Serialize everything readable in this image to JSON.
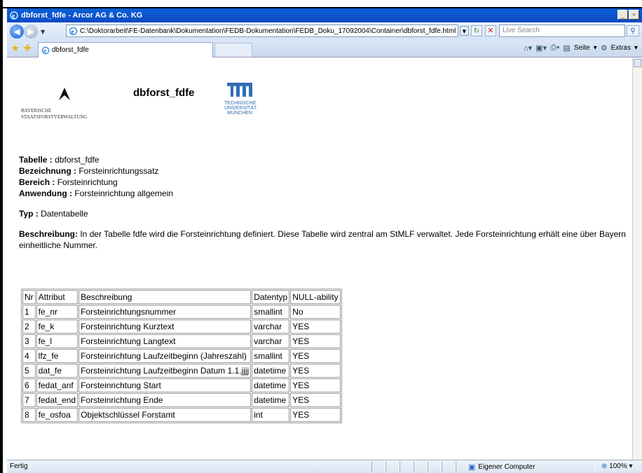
{
  "window": {
    "title": "dbforst_fdfe - Arcor AG & Co. KG",
    "controls": {
      "minimize": "_",
      "restore": "҉"
    }
  },
  "addressbar": {
    "url": "C:\\Doktorarbeit\\FE-Datenbank\\Dokumentation\\FEDB-Dokumentation\\FEDB_Doku_17092004\\Container\\dbforst_fdfe.html",
    "search_placeholder": "Live Search"
  },
  "tabs": {
    "active_tab": "dbforst_fdfe"
  },
  "commandbar": {
    "page_label": "Seite",
    "extras_label": "Extras"
  },
  "page": {
    "logo_left_line1": "BAYERISCHE",
    "logo_left_line2": "STAATSFORSTVERWALTUNG",
    "heading": "dbforst_fdfe",
    "logo_right_mark": "TUM",
    "logo_right_line1": "TECHNISCHE",
    "logo_right_line2": "UNIVERSITÄT",
    "logo_right_line3": "MÜNCHEN",
    "fields": {
      "tabelle_label": "Tabelle :",
      "tabelle_value": " dbforst_fdfe",
      "bezeichnung_label": "Bezeichnung :",
      "bezeichnung_value": " Forsteinrichtungssatz",
      "bereich_label": "Bereich :",
      "bereich_value": " Forsteinrichtung",
      "anwendung_label": "Anwendung :",
      "anwendung_value": " Forsteinrichtung allgemein",
      "typ_label": "Typ :",
      "typ_value": " Datentabelle",
      "beschreibung_label": "Beschreibung:",
      "beschreibung_value": " In der Tabelle fdfe wird die Forsteinrichtung definiert. Diese Tabelle wird zentral am StMLF verwaltet. Jede Forsteinrichtung erhält eine über Bayern einheitliche Nummer."
    },
    "table": {
      "headers": [
        "Nr",
        "Attribut",
        "Beschreibung",
        "Datentyp",
        "NULL-ability"
      ],
      "rows": [
        [
          "1",
          "fe_nr",
          "Forsteinrichtungsnummer",
          "smallint",
          "No"
        ],
        [
          "2",
          "fe_k",
          "Forsteinrichtung Kurztext",
          "varchar",
          "YES"
        ],
        [
          "3",
          "fe_l",
          "Forsteinrichtung Langtext",
          "varchar",
          "YES"
        ],
        [
          "4",
          "lfz_fe",
          "Forsteinrichtung Laufzeitbeginn (Jahreszahl)",
          "smallint",
          "YES"
        ],
        [
          "5",
          "dat_fe",
          "Forsteinrichtung Laufzeitbeginn Datum 1.1.jjjj",
          "datetime",
          "YES"
        ],
        [
          "6",
          "fedat_anf",
          "Forsteinrichtung Start",
          "datetime",
          "YES"
        ],
        [
          "7",
          "fedat_end",
          "Forsteinrichtung Ende",
          "datetime",
          "YES"
        ],
        [
          "8",
          "fe_osfoa",
          "Objektschlüssel Forstamt",
          "int",
          "YES"
        ]
      ]
    }
  },
  "statusbar": {
    "status": "Fertig",
    "zone": "Eigener Computer",
    "zoom": "100%"
  }
}
